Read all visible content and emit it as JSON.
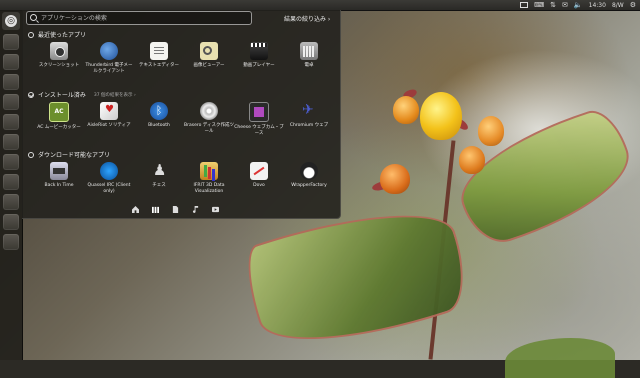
{
  "top_panel": {
    "time": "14:30",
    "status_extra": "8/W"
  },
  "dash": {
    "search_placeholder": "アプリケーションの検索",
    "filter_label": "結果の絞り込み ›",
    "sections": {
      "recent": {
        "title": "最近使ったアプリ",
        "apps": [
          {
            "label": "スクリーンショット",
            "icon": "camera-icon"
          },
          {
            "label": "Thunderbird 電子メールクライアント",
            "icon": "thunderbird-icon"
          },
          {
            "label": "テキストエディター",
            "icon": "text-editor-icon"
          },
          {
            "label": "画像ビューアー",
            "icon": "image-viewer-icon"
          },
          {
            "label": "動画プレイヤー",
            "icon": "video-clapper-icon"
          },
          {
            "label": "電卓",
            "icon": "calculator-icon"
          }
        ]
      },
      "installed": {
        "title": "インストール済み",
        "subtitle": "37 個の結果を表示 ›",
        "apps": [
          {
            "label": "AC ムービーカッター",
            "icon": "ac-icon"
          },
          {
            "label": "AisleRiot ソリティア",
            "icon": "cards-icon"
          },
          {
            "label": "Bluetooth",
            "icon": "bluetooth-icon"
          },
          {
            "label": "Brasero ディスク作成ツール",
            "icon": "disc-icon"
          },
          {
            "label": "Cheese ウェブカム・ブース",
            "icon": "webcam-icon"
          },
          {
            "label": "Chromium ウェブ",
            "icon": "jet-icon"
          }
        ]
      },
      "downloadable": {
        "title": "ダウンロード可能なアプリ",
        "apps": [
          {
            "label": "Back In Time",
            "icon": "backup-icon"
          },
          {
            "label": "Quassel IRC (Client only)",
            "icon": "quassel-icon"
          },
          {
            "label": "チェス",
            "icon": "chess-icon"
          },
          {
            "label": "IFRIT 3D Data Visualization",
            "icon": "ifrit-icon"
          },
          {
            "label": "Dovo",
            "icon": "dovo-icon"
          },
          {
            "label": "WrapperFactory",
            "icon": "wrapper-icon"
          }
        ]
      }
    },
    "lenses": [
      "home-lens-icon",
      "apps-lens-icon",
      "files-lens-icon",
      "music-lens-icon",
      "video-lens-icon"
    ]
  }
}
